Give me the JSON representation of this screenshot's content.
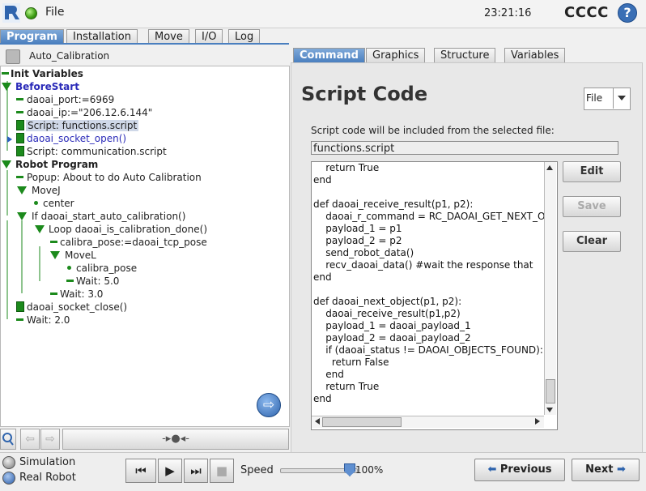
{
  "header": {
    "file_menu": "File",
    "clock": "23:21:16",
    "robot_name": "CCCC",
    "help": "?"
  },
  "main_tabs": [
    {
      "label": "Program",
      "active": true
    },
    {
      "label": "Installation",
      "active": false
    },
    {
      "label": "Move",
      "active": false
    },
    {
      "label": "I/O",
      "active": false
    },
    {
      "label": "Log",
      "active": false
    }
  ],
  "program": {
    "name": "Auto_Calibration",
    "tree": [
      {
        "text": "Init Variables",
        "icon": "dash-icon"
      },
      {
        "text": "BeforeStart",
        "icon": "triangle-icon"
      },
      {
        "text": "daoai_port:=6969",
        "icon": "dash-icon"
      },
      {
        "text": "daoai_ip:=\"206.12.6.144\"",
        "icon": "dash-icon"
      },
      {
        "text": "Script: functions.script",
        "icon": "script-icon",
        "selected": true
      },
      {
        "text": "daoai_socket_open()",
        "icon": "script-icon"
      },
      {
        "text": "Script: communication.script",
        "icon": "script-icon"
      },
      {
        "text": "Robot Program",
        "icon": "triangle-icon"
      },
      {
        "text": "Popup: About to do Auto Calibration",
        "icon": "dash-icon"
      },
      {
        "text": "MoveJ",
        "icon": "triangle-icon"
      },
      {
        "text": "center",
        "icon": "waypoint-icon"
      },
      {
        "text": "If daoai_start_auto_calibration()",
        "icon": "triangle-icon"
      },
      {
        "text": "Loop daoai_is_calibration_done()",
        "icon": "triangle-icon"
      },
      {
        "text": "calibra_pose:=daoai_tcp_pose",
        "icon": "dash-icon"
      },
      {
        "text": "MoveL",
        "icon": "triangle-icon"
      },
      {
        "text": "calibra_pose",
        "icon": "waypoint-icon"
      },
      {
        "text": "Wait: 5.0",
        "icon": "dash-icon"
      },
      {
        "text": "Wait: 3.0",
        "icon": "dash-icon"
      },
      {
        "text": "daoai_socket_close()",
        "icon": "script-icon"
      },
      {
        "text": "Wait: 2.0",
        "icon": "dash-icon"
      }
    ]
  },
  "toolbar_left": {
    "wire_symbol": "-▸●◂-"
  },
  "right_tabs": [
    {
      "label": "Command",
      "active": true
    },
    {
      "label": "Graphics",
      "active": false
    },
    {
      "label": "Structure",
      "active": false
    },
    {
      "label": "Variables",
      "active": false
    }
  ],
  "command": {
    "title": "Script Code",
    "source_select": "File",
    "description": "Script code will be included from the selected file:",
    "filename": "functions.script",
    "code": [
      "    return True",
      "end",
      "",
      "def daoai_receive_result(p1, p2):",
      "    daoai_r_command = RC_DAOAI_GET_NEXT_O",
      "    payload_1 = p1",
      "    payload_2 = p2",
      "    send_robot_data()",
      "    recv_daoai_data() #wait the response that",
      "end",
      "",
      "def daoai_next_object(p1, p2):",
      "    daoai_receive_result(p1,p2)",
      "    payload_1 = daoai_payload_1",
      "    payload_2 = daoai_payload_2",
      "    if (daoai_status != DAOAI_OBJECTS_FOUND):",
      "      return False",
      "    end",
      "    return True",
      "end"
    ],
    "buttons": {
      "edit": "Edit",
      "save": "Save",
      "clear": "Clear"
    }
  },
  "bottom": {
    "simulation": "Simulation",
    "real_robot": "Real Robot",
    "speed_label": "Speed",
    "speed_value": "100%",
    "speed_fraction": 1.0,
    "previous": "Previous",
    "next": "Next"
  },
  "colors": {
    "accent": "#4a7fbf",
    "program_green": "#1c8a1c",
    "link_blue": "#2a2ab8"
  }
}
